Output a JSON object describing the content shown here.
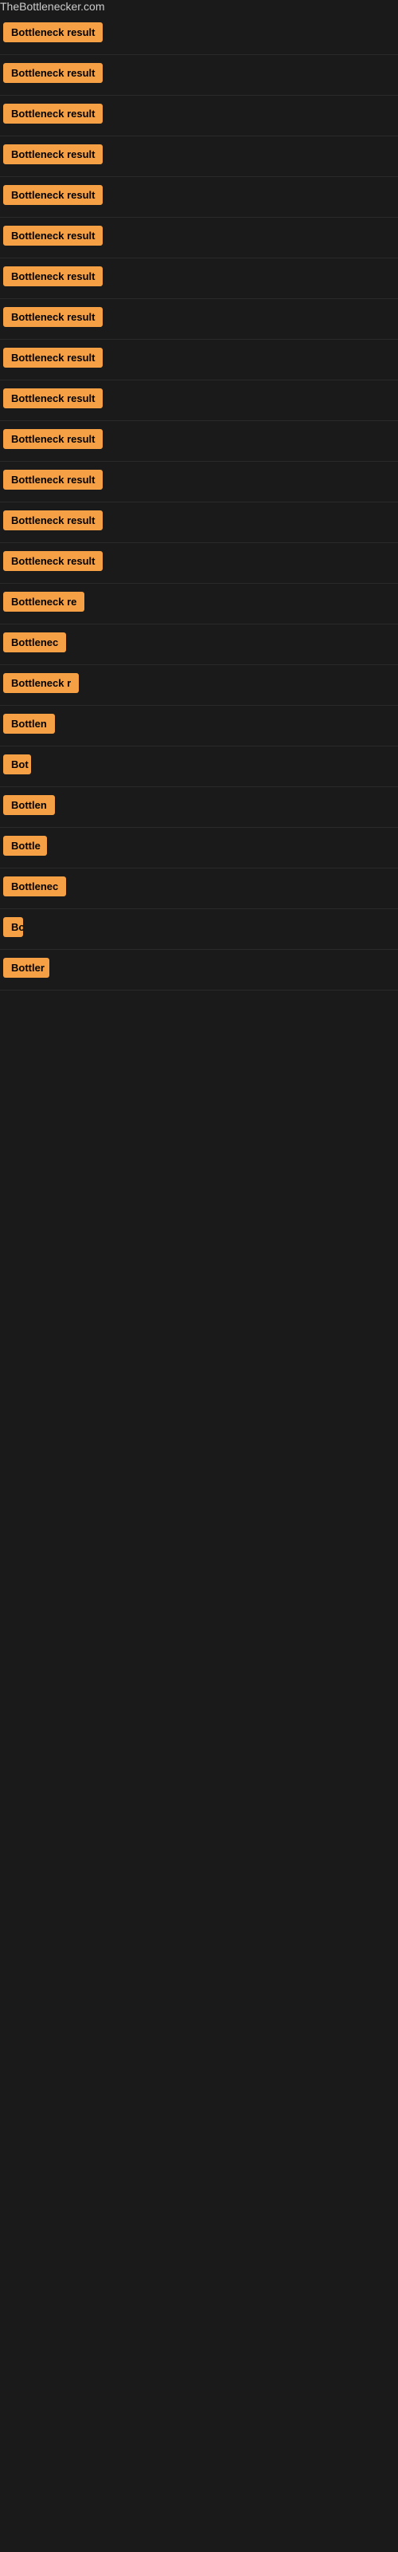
{
  "header": {
    "site_name": "TheBottlenecker.com"
  },
  "results": [
    {
      "id": 1,
      "label": "Bottleneck result",
      "visible_width": "full"
    },
    {
      "id": 2,
      "label": "Bottleneck result",
      "visible_width": "full"
    },
    {
      "id": 3,
      "label": "Bottleneck result",
      "visible_width": "full"
    },
    {
      "id": 4,
      "label": "Bottleneck result",
      "visible_width": "full"
    },
    {
      "id": 5,
      "label": "Bottleneck result",
      "visible_width": "full"
    },
    {
      "id": 6,
      "label": "Bottleneck result",
      "visible_width": "full"
    },
    {
      "id": 7,
      "label": "Bottleneck result",
      "visible_width": "full"
    },
    {
      "id": 8,
      "label": "Bottleneck result",
      "visible_width": "full"
    },
    {
      "id": 9,
      "label": "Bottleneck result",
      "visible_width": "full"
    },
    {
      "id": 10,
      "label": "Bottleneck result",
      "visible_width": "full"
    },
    {
      "id": 11,
      "label": "Bottleneck result",
      "visible_width": "full"
    },
    {
      "id": 12,
      "label": "Bottleneck result",
      "visible_width": "full"
    },
    {
      "id": 13,
      "label": "Bottleneck result",
      "visible_width": "full"
    },
    {
      "id": 14,
      "label": "Bottleneck result",
      "visible_width": "full"
    },
    {
      "id": 15,
      "label": "Bottleneck re",
      "visible_width": "truncated-lg"
    },
    {
      "id": 16,
      "label": "Bottlenec",
      "visible_width": "truncated-md"
    },
    {
      "id": 17,
      "label": "Bottleneck r",
      "visible_width": "truncated-lg2"
    },
    {
      "id": 18,
      "label": "Bottlen",
      "visible_width": "truncated-sm"
    },
    {
      "id": 19,
      "label": "Bot",
      "visible_width": "truncated-xs"
    },
    {
      "id": 20,
      "label": "Bottlen",
      "visible_width": "truncated-sm"
    },
    {
      "id": 21,
      "label": "Bottle",
      "visible_width": "truncated-sm2"
    },
    {
      "id": 22,
      "label": "Bottlenec",
      "visible_width": "truncated-md"
    },
    {
      "id": 23,
      "label": "Bo",
      "visible_width": "truncated-xxs"
    },
    {
      "id": 24,
      "label": "Bottler",
      "visible_width": "truncated-sm3"
    }
  ],
  "badge": {
    "background_color": "#f5a045",
    "text_color": "#000000"
  }
}
